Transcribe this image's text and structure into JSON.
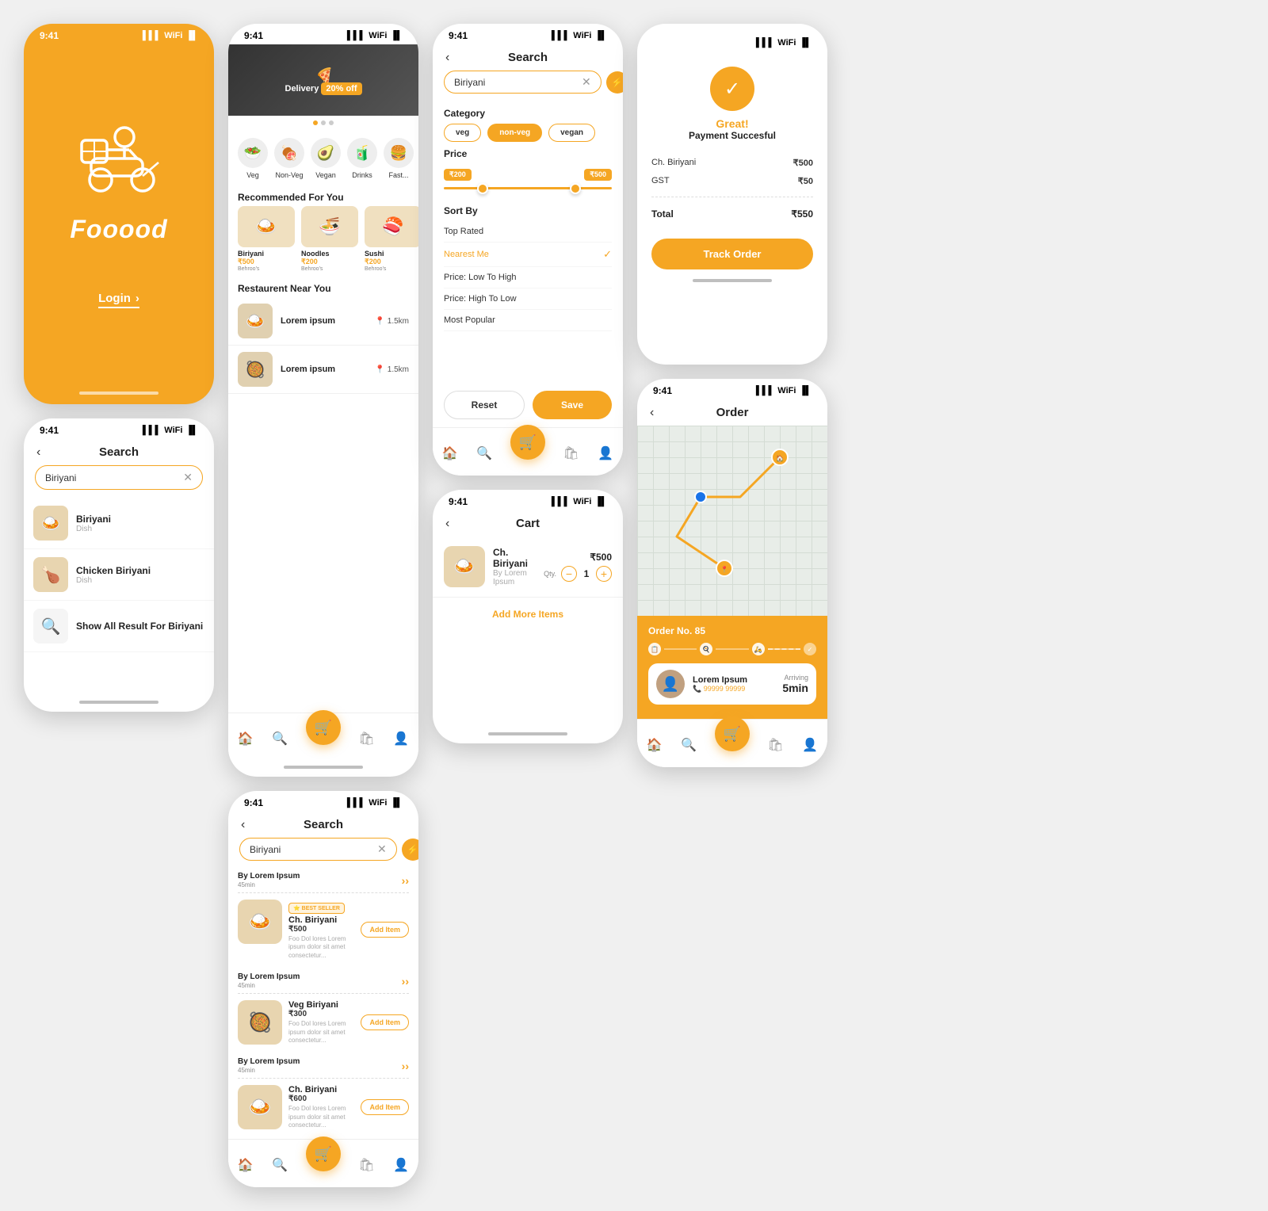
{
  "app": {
    "name": "Fooood",
    "time": "9:41",
    "signal": "▌▌▌",
    "wifi": "WiFi",
    "battery": "🔋"
  },
  "splash": {
    "login_label": "Login",
    "logo": "Fooood"
  },
  "home": {
    "categories": [
      {
        "label": "Veg",
        "emoji": "🥗"
      },
      {
        "label": "Non-Veg",
        "emoji": "🍖"
      },
      {
        "label": "Vegan",
        "emoji": "🥑"
      },
      {
        "label": "Drinks",
        "emoji": "🧃"
      },
      {
        "label": "Fast...",
        "emoji": "🍔"
      }
    ],
    "recommended_title": "Recommended For You",
    "recommended": [
      {
        "name": "Biriyani",
        "price": "₹500",
        "shop": "Behroo's",
        "emoji": "🍛"
      },
      {
        "name": "Noodles",
        "price": "₹200",
        "shop": "Behroo's",
        "emoji": "🍜"
      },
      {
        "name": "Sushi",
        "price": "₹200",
        "shop": "Behroo's",
        "emoji": "🍣"
      }
    ],
    "nearby_title": "Restaurent Near You",
    "nearby": [
      {
        "name": "Lorem ipsum",
        "dist": "1.5km",
        "emoji": "🍛"
      },
      {
        "name": "Lorem ipsum",
        "dist": "1.5km",
        "emoji": "🥘"
      }
    ]
  },
  "search_filter": {
    "title": "Search",
    "placeholder": "Biriyani",
    "category_label": "Category",
    "categories": [
      {
        "label": "veg",
        "active": false
      },
      {
        "label": "non-veg",
        "active": true
      },
      {
        "label": "vegan",
        "active": false
      }
    ],
    "price_label": "Price",
    "price_min": "₹200",
    "price_max": "₹500",
    "sortby_label": "Sort By",
    "sortby_items": [
      {
        "label": "Top Rated",
        "active": false
      },
      {
        "label": "Nearest Me",
        "active": true
      },
      {
        "label": "Price: Low To High",
        "active": false
      },
      {
        "label": "Price: High To Low",
        "active": false
      },
      {
        "label": "Most Popular",
        "active": false
      }
    ],
    "reset_label": "Reset",
    "save_label": "Save"
  },
  "search_results": {
    "title": "Search",
    "placeholder": "Biriyani",
    "groups": [
      {
        "shop": "By Lorem Ipsum",
        "time": "45min",
        "items": [
          {
            "name": "Ch. Biriyani",
            "price": "₹500",
            "badge": "BEST SELLER",
            "desc": "Foo Dol lores Lorem ipsum dolor sit amet. Consectetur adipiscing elit. Lorem ipsum ullamcorper nisi dictum velit.",
            "emoji": "🍛",
            "add_label": "Add Item"
          }
        ]
      },
      {
        "shop": "By Lorem Ipsum",
        "time": "45min",
        "items": [
          {
            "name": "Veg Biriyani",
            "price": "₹300",
            "badge": "",
            "desc": "Foo Dol lores Lorem ipsum dolor sit amet. Consectetur adipiscing elit.",
            "emoji": "🥘",
            "add_label": "Add Item"
          }
        ]
      },
      {
        "shop": "By Lorem Ipsum",
        "time": "45min",
        "items": [
          {
            "name": "Ch. Biriyani",
            "price": "₹600",
            "badge": "",
            "desc": "Foo Dol lores Lorem ipsum dolor sit amet. Consectetur adipiscing elit.",
            "emoji": "🍛",
            "add_label": "Add Item"
          }
        ]
      }
    ]
  },
  "search_suggestions": {
    "title": "Search",
    "placeholder": "Biriyani",
    "suggestions": [
      {
        "name": "Biriyani",
        "type": "Dish",
        "emoji": "🍛"
      },
      {
        "name": "Chicken Biriyani",
        "type": "Dish",
        "emoji": "🍗"
      },
      {
        "name": "Show All Result For",
        "bold": "Biriyani",
        "type": "search",
        "emoji": "🔍"
      }
    ]
  },
  "cart": {
    "title": "Cart",
    "item": {
      "name": "Ch. Biriyani",
      "shop": "By Lorem Ipsum",
      "price": "₹500",
      "qty": 1,
      "emoji": "🍛"
    },
    "qty_label": "Qty.",
    "add_more_label": "Add More Items"
  },
  "payment": {
    "icon": "✓",
    "great_label": "Great!",
    "subtitle": "Payment Succesful",
    "rows": [
      {
        "label": "Ch. Biriyani",
        "amount": "₹500"
      },
      {
        "label": "GST",
        "amount": "₹50"
      }
    ],
    "total_label": "Total",
    "total_amount": "₹550",
    "track_label": "Track Order"
  },
  "order": {
    "title": "Order",
    "order_no": "Order No. 85",
    "driver_name": "Lorem Ipsum",
    "driver_phone": "📞 99999 99999",
    "arriving_label": "Arriving",
    "arriving_time": "5min"
  }
}
